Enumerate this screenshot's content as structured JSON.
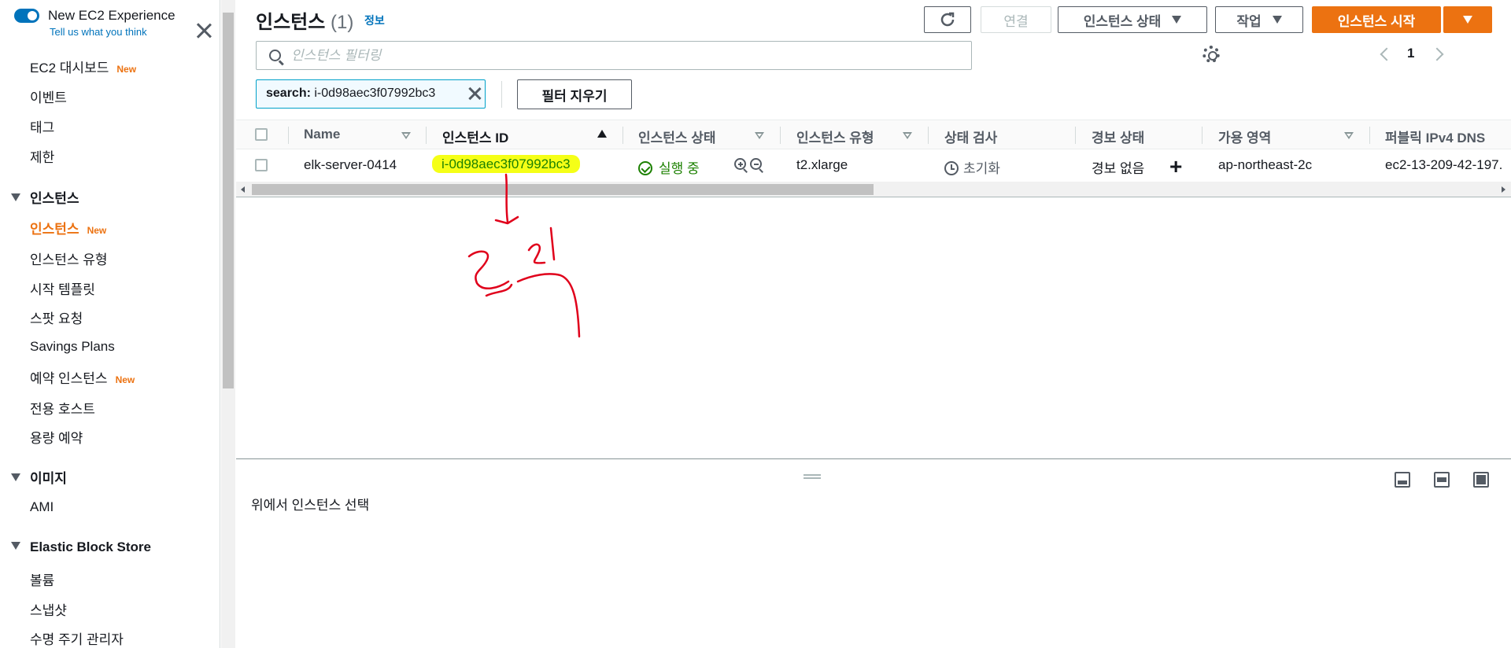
{
  "sidebar": {
    "toggle_title": "New EC2 Experience",
    "toggle_sub": "Tell us what you think",
    "new_badge": "New",
    "items": {
      "dashboard": "EC2 대시보드",
      "events": "이벤트",
      "tags": "태그",
      "limits": "제한",
      "instances_section": "인스턴스",
      "instances": "인스턴스",
      "instance_types": "인스턴스 유형",
      "launch_templates": "시작 템플릿",
      "spot_requests": "스팟 요청",
      "savings_plans": "Savings Plans",
      "reserved_instances": "예약 인스턴스",
      "dedicated_hosts": "전용 호스트",
      "capacity_reservations": "용량 예약",
      "images_section": "이미지",
      "ami": "AMI",
      "ebs_section": "Elastic Block Store",
      "volumes": "볼륨",
      "snapshots": "스냅샷",
      "lifecycle_manager": "수명 주기 관리자"
    }
  },
  "header": {
    "title": "인스턴스",
    "count": "(1)",
    "info": "정보"
  },
  "toolbar": {
    "connect": "연결",
    "instance_state": "인스턴스 상태",
    "actions": "작업",
    "launch": "인스턴스 시작"
  },
  "search": {
    "placeholder": "인스턴스 필터링",
    "token_key": "search:",
    "token_value": "i-0d98aec3f07992bc3",
    "clear_filters": "필터 지우기"
  },
  "pagination": {
    "page": "1"
  },
  "table": {
    "columns": {
      "name": "Name",
      "instance_id": "인스턴스 ID",
      "instance_state": "인스턴스 상태",
      "instance_type": "인스턴스 유형",
      "status_check": "상태 검사",
      "alarm_status": "경보 상태",
      "availability_zone": "가용 영역",
      "public_dns": "퍼블릭 IPv4 DNS"
    },
    "rows": [
      {
        "name": "elk-server-0414",
        "instance_id": "i-0d98aec3f07992bc3",
        "instance_state": "실행 중",
        "instance_type": "t2.xlarge",
        "status_check": "초기화",
        "alarm_status": "경보 없음",
        "availability_zone": "ap-northeast-2c",
        "public_dns": "ec2-13-209-42-197."
      }
    ]
  },
  "bottom_panel": {
    "message": "위에서 인스턴스 선택"
  },
  "colors": {
    "accent": "#ec7211",
    "link": "#0073bb",
    "running": "#1d8102",
    "highlight": "#f5ff17",
    "annotation": "#e0001b"
  }
}
